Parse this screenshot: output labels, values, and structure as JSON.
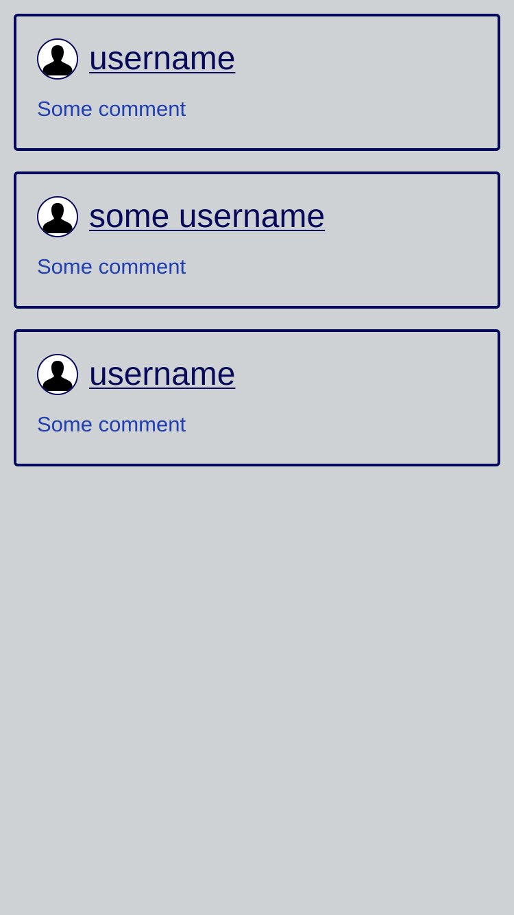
{
  "comments": [
    {
      "username": "username",
      "comment": "Some comment",
      "avatar_icon": "user-silhouette-icon"
    },
    {
      "username": "some username",
      "comment": "Some comment",
      "avatar_icon": "user-silhouette-icon"
    },
    {
      "username": "username",
      "comment": "Some comment",
      "avatar_icon": "user-silhouette-icon"
    }
  ],
  "colors": {
    "background": "#cfd2d5",
    "border": "#07095a",
    "username": "#07095a",
    "comment": "#1f3fb3"
  }
}
